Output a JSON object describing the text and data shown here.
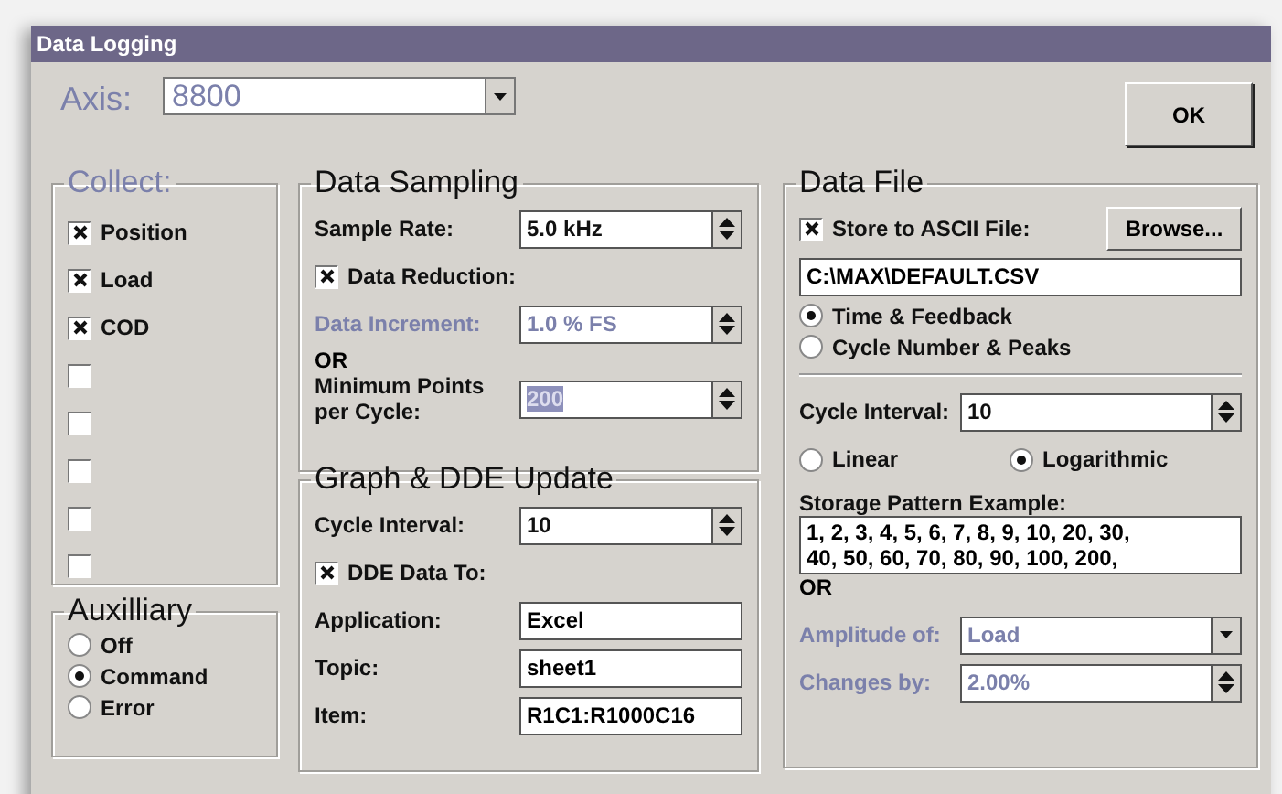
{
  "window": {
    "title": "Data Logging"
  },
  "axis": {
    "label": "Axis:",
    "value": "8800"
  },
  "ok_button": {
    "label": "OK"
  },
  "collect": {
    "title": "Collect:",
    "items": [
      {
        "label": "Position",
        "checked": true
      },
      {
        "label": "Load",
        "checked": true
      },
      {
        "label": "COD",
        "checked": true
      },
      {
        "checked": false
      },
      {
        "checked": false
      },
      {
        "checked": false
      },
      {
        "checked": false
      },
      {
        "checked": false
      }
    ]
  },
  "auxiliary": {
    "title": "Auxilliary",
    "options": [
      {
        "label": "Off",
        "selected": false
      },
      {
        "label": "Command",
        "selected": true
      },
      {
        "label": "Error",
        "selected": false
      }
    ]
  },
  "data_sampling": {
    "title": "Data Sampling",
    "rows": [
      {
        "kind": "spin",
        "label": "Sample Rate:",
        "value": "5.0 kHz",
        "disabled": false,
        "highlighted": false
      },
      {
        "kind": "check",
        "label": "Data Reduction:",
        "checked": true
      },
      {
        "kind": "spin",
        "label": "Data Increment:",
        "value": "1.0 % FS",
        "disabled": true,
        "highlighted": false
      },
      {
        "kind": "note",
        "text": "OR"
      },
      {
        "kind": "spin",
        "label": "Minimum Points per Cycle:",
        "value": "200",
        "disabled": false,
        "highlighted": true
      }
    ]
  },
  "graph_dde": {
    "title": "Graph & DDE Update",
    "rows": [
      {
        "kind": "spin",
        "label": "Cycle Interval:",
        "value": "10",
        "disabled": false,
        "highlighted": false
      },
      {
        "kind": "check",
        "label": "DDE Data To:",
        "checked": true
      },
      {
        "kind": "text",
        "label": "Application:",
        "value": "Excel"
      },
      {
        "kind": "text",
        "label": "Topic:",
        "value": "sheet1"
      },
      {
        "kind": "text",
        "label": "Item:",
        "value": "R1C1:R1000C16"
      }
    ]
  },
  "data_file": {
    "title": "Data File",
    "rows": [
      {
        "kind": "check-browse",
        "label": "Store to ASCII File:",
        "checked": true,
        "button": "Browse..."
      },
      {
        "kind": "path",
        "value": "C:\\MAX\\DEFAULT.CSV"
      },
      {
        "kind": "radio",
        "label": "Time & Feedback",
        "selected": true
      },
      {
        "kind": "radio",
        "label": "Cycle Number & Peaks",
        "selected": false
      },
      {
        "kind": "divider"
      },
      {
        "kind": "spin",
        "label": "Cycle Interval:",
        "value": "10",
        "disabled": false,
        "highlighted": false
      },
      {
        "kind": "radio-pair",
        "options": [
          {
            "label": "Linear",
            "selected": false
          },
          {
            "label": "Logarithmic",
            "selected": true
          }
        ]
      },
      {
        "kind": "caption",
        "text": "Storage Pattern Example:"
      },
      {
        "kind": "textarea",
        "lines": [
          "1, 2, 3, 4, 5, 6, 7, 8, 9, 10, 20, 30,",
          "40, 50, 60, 70, 80, 90, 100, 200,"
        ]
      },
      {
        "kind": "note",
        "text": "OR"
      },
      {
        "kind": "dropdown",
        "label": "Amplitude of:",
        "value": "Load",
        "disabled": true
      },
      {
        "kind": "spin",
        "label": "Changes by:",
        "value": "2.00%",
        "disabled": true,
        "highlighted": false
      }
    ]
  }
}
